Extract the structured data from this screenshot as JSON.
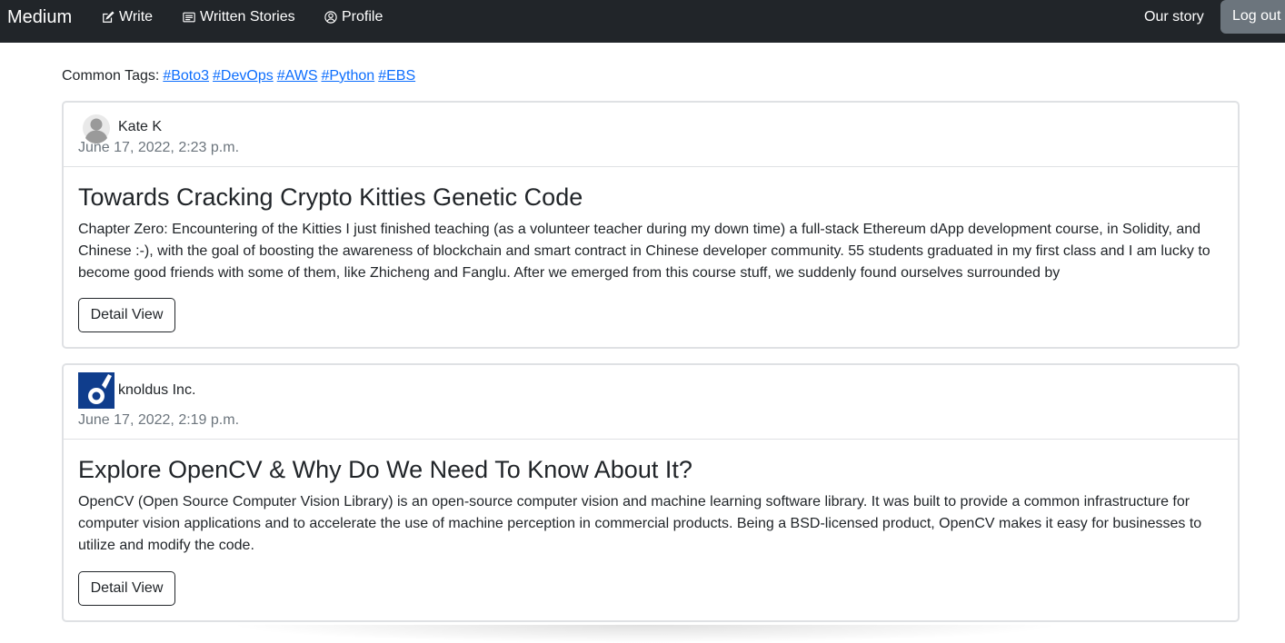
{
  "navbar": {
    "brand": "Medium",
    "write": "Write",
    "written_stories": "Written Stories",
    "profile": "Profile",
    "our_story": "Our story",
    "logout": "Log out",
    "background": "#212529"
  },
  "tags": {
    "label": "Common Tags:",
    "items": [
      "#Boto3",
      "#DevOps",
      "#AWS",
      "#Python",
      "#EBS"
    ],
    "link_color": "#0d6efd"
  },
  "posts": [
    {
      "author": "Kate K",
      "avatar_icon": "default-user-avatar",
      "date": "June 17, 2022, 2:23 p.m.",
      "title": "Towards Cracking Crypto Kitties Genetic Code",
      "excerpt": "Chapter Zero: Encountering of the Kitties I just finished teaching (as a volunteer teacher during my down time) a full-stack Ethereum dApp development course, in Solidity, and Chinese :-), with the goal of boosting the awareness of blockchain and smart contract in Chinese developer community. 55 students graduated in my first class and I am lucky to become good friends with some of them, like Zhicheng and Fanglu. After we emerged from this course stuff, we suddenly found ourselves surrounded by",
      "button": "Detail View"
    },
    {
      "author": "knoldus Inc.",
      "avatar_icon": "knoldus-logo",
      "date": "June 17, 2022, 2:19 p.m.",
      "title": "Explore OpenCV & Why Do We Need To Know About It?",
      "excerpt": "OpenCV (Open Source Computer Vision Library) is an open-source computer vision and machine learning software library. It was built to provide a common infrastructure for computer vision applications and to accelerate the use of machine perception in commercial products. Being a BSD-licensed product, OpenCV makes it easy for businesses to utilize and modify the code.",
      "button": "Detail View"
    }
  ]
}
